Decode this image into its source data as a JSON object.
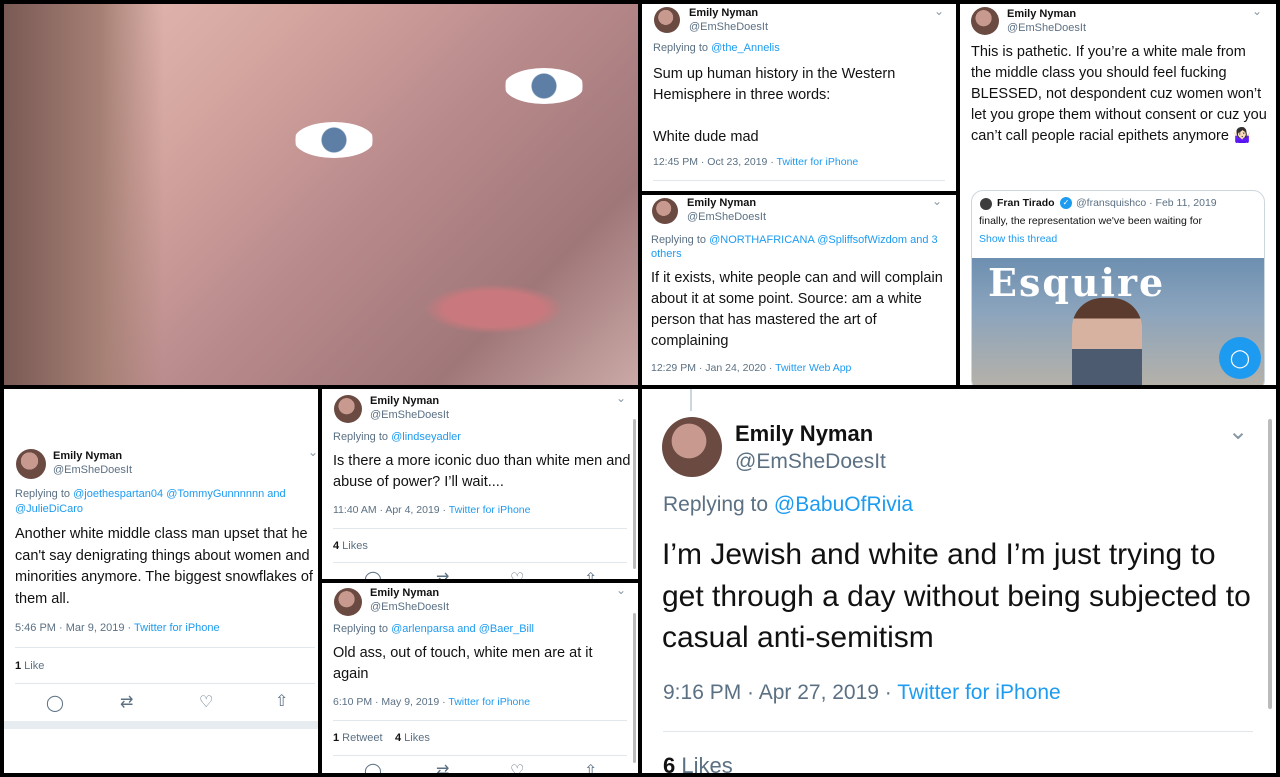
{
  "profile": {
    "name": "Emily Nyman",
    "handle": "@EmShe​DoesIt"
  },
  "tweets": [
    {
      "replying_prefix": "Replying to ",
      "replying_to": "@the_Annelis",
      "text": "Sum up human history in the Western Hemisphere in three words:\n\nWhite dude mad",
      "time": "12:45 PM · Oct 23, 2019 · ",
      "source": "Twitter for iPhone"
    },
    {
      "replying_prefix": "Replying to ",
      "replying_to": "@NORTHAFRICANA @SpliffsofWizdom and 3 others",
      "text": "If it exists, white people can and will complain about it at some point. Source: am a white person that has mastered the art of complaining",
      "time": "12:29 PM · Jan 24, 2020 · ",
      "source": "Twitter Web App"
    },
    {
      "text": "This is pathetic. If you’re a white male from the middle class you should feel fucking BLESSED, not despondent cuz women won’t let you grope them without consent or cuz you can’t call people racial epithets anymore 🤷🏻‍♀️",
      "quote": {
        "name": "Fran Tirado",
        "handle_date": "@fransquishco · Feb 11, 2019",
        "text": "finally, the representation we've been waiting for",
        "show_thread": "Show this thread",
        "magazine_title": "Esquire"
      }
    },
    {
      "replying_prefix": "Replying to ",
      "replying_to": "@joethespartan04 @TommyGunnnnnn and @JulieDiCaro",
      "text": "Another white middle class man upset that he can't say denigrating things about women and minorities anymore. The biggest snowflakes of them all.",
      "time": "5:46 PM · Mar 9, 2019 · ",
      "source": "Twitter for iPhone",
      "likes_count": "1",
      "likes_label": " Like"
    },
    {
      "replying_prefix": "Replying to ",
      "replying_to": "@lindseyadler",
      "text": "Is there a more iconic duo than white men and abuse of power? I’ll wait....",
      "time": "11:40 AM · Apr 4, 2019 · ",
      "source": "Twitter for iPhone",
      "likes_count": "4",
      "likes_label": " Likes"
    },
    {
      "replying_prefix": "Replying to ",
      "replying_to": "@arlenparsa and @Baer_Bill",
      "text": "Old ass, out of touch, white men are at it again",
      "time": "6:10 PM · May 9, 2019 · ",
      "source": "Twitter for iPhone",
      "retweets_count": "1",
      "retweets_label": " Retweet",
      "likes_count": "4",
      "likes_label": " Likes"
    },
    {
      "replying_prefix": "Replying to ",
      "replying_to": "@BabuOfRivia",
      "text": "I’m Jewish and white and I’m just trying to get through a day without being subjected to casual anti-semitism",
      "time": "9:16 PM · Apr 27, 2019 · ",
      "source": "Twitter for iPhone",
      "likes_count": "6",
      "likes_label": " Likes"
    }
  ],
  "icons": {
    "reply": "reply-icon",
    "retweet": "retweet-icon",
    "like": "heart-icon",
    "share": "share-icon",
    "chevron": "chevron-down-icon",
    "verified": "verified-badge-icon"
  },
  "colors": {
    "link": "#1d9bf0",
    "muted": "#5b7083",
    "text": "#111111"
  }
}
